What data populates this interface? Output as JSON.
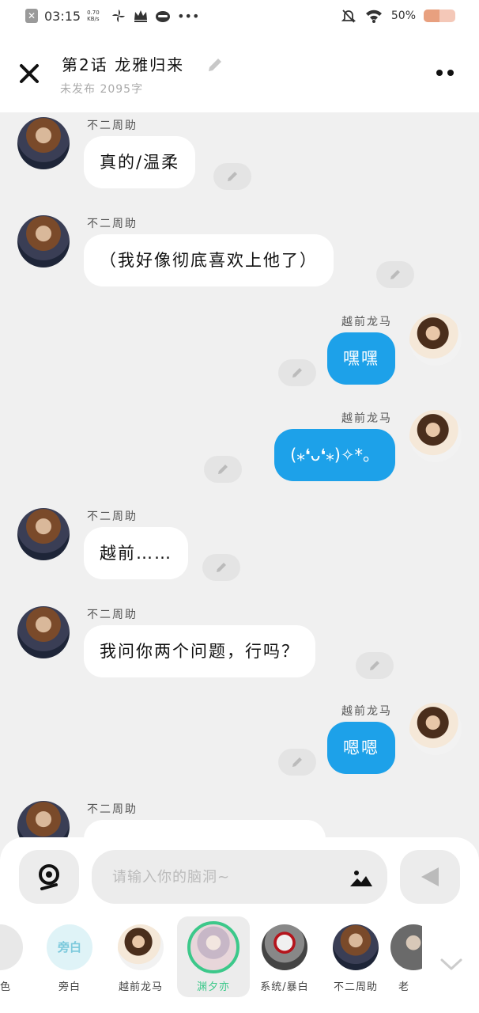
{
  "status_bar": {
    "time": "03:15",
    "net_speed": "0.70",
    "net_unit": "KB/s",
    "battery_text": "50%",
    "battery_level": 0.5,
    "icons": [
      "close-badge-icon",
      "pinwheel-icon",
      "crown-icon",
      "ninja-icon",
      "more-dots-icon",
      "mute-bell-icon",
      "wifi-icon",
      "battery-icon"
    ]
  },
  "header": {
    "title": "第2话  龙雅归来",
    "subtitle": "未发布  2095字"
  },
  "messages": [
    {
      "side": "left",
      "name": "不二周助",
      "text": "真的/温柔"
    },
    {
      "side": "left",
      "name": "不二周助",
      "text": "（我好像彻底喜欢上他了）"
    },
    {
      "side": "right",
      "name": "越前龙马",
      "text": "嘿嘿"
    },
    {
      "side": "right",
      "name": "越前龙马",
      "text": "(⁎❛ᴗ❛⁎)✧*。"
    },
    {
      "side": "left",
      "name": "不二周助",
      "text": "越前……"
    },
    {
      "side": "left",
      "name": "不二周助",
      "text": "我问你两个问题，行吗？"
    },
    {
      "side": "right",
      "name": "越前龙马",
      "text": "嗯嗯"
    },
    {
      "side": "left",
      "name": "不二周助",
      "text": ""
    }
  ],
  "input": {
    "placeholder": "请输入你的脑洞~"
  },
  "roles": [
    {
      "label": "角色",
      "selected": false
    },
    {
      "label": "旁白",
      "avatar_text": "旁白",
      "selected": false
    },
    {
      "label": "越前龙马",
      "selected": false
    },
    {
      "label": "渊夕亦",
      "selected": true
    },
    {
      "label": "系统/暴白",
      "selected": false
    },
    {
      "label": "不二周助",
      "selected": false
    },
    {
      "label": "老",
      "selected": false
    }
  ],
  "colors": {
    "accent_blue": "#1da1e9",
    "selected_green": "#3cc88a",
    "background": "#f0f0f0"
  }
}
